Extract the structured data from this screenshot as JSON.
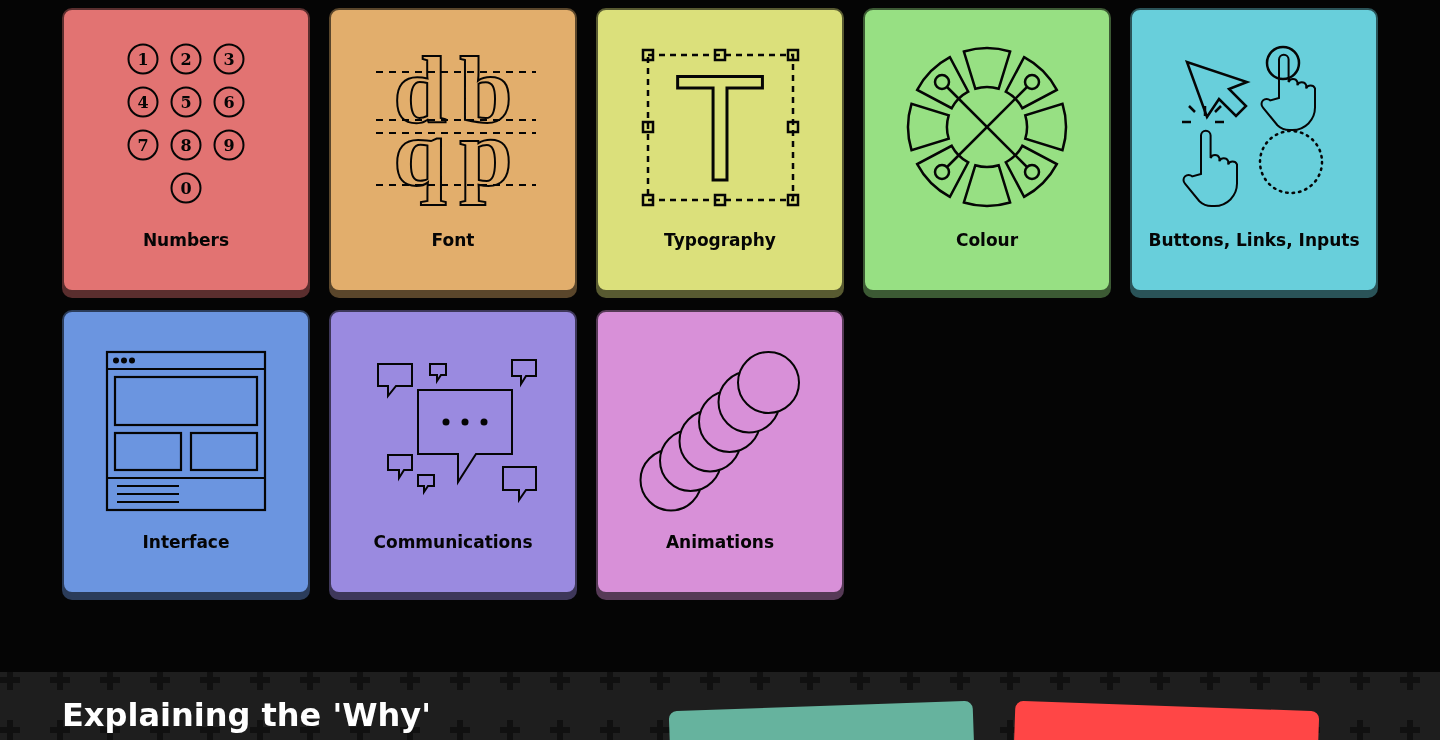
{
  "tiles": [
    {
      "label": "Numbers",
      "kind": "numbers",
      "color": "#e27372",
      "digits": [
        "1",
        "2",
        "3",
        "4",
        "5",
        "6",
        "7",
        "8",
        "9",
        "0"
      ]
    },
    {
      "label": "Font",
      "kind": "font",
      "color": "#e2ae6c",
      "letters": [
        "d",
        "b",
        "q",
        "p"
      ]
    },
    {
      "label": "Typography",
      "kind": "typography",
      "color": "#dbe07b",
      "glyph": "T"
    },
    {
      "label": "Colour",
      "kind": "colour",
      "color": "#97e083"
    },
    {
      "label": "Buttons, Links, Inputs",
      "kind": "buttons",
      "color": "#68cfdb"
    },
    {
      "label": "Interface",
      "kind": "interface",
      "color": "#6b95e0"
    },
    {
      "label": "Communications",
      "kind": "communications",
      "color": "#9a8ae0"
    },
    {
      "label": "Animations",
      "kind": "animations",
      "color": "#d890d8"
    }
  ],
  "footer": {
    "heading": "Explaining the 'Why'",
    "cards": [
      {
        "color": "#66b39e"
      },
      {
        "color": "#ff4646"
      }
    ]
  }
}
